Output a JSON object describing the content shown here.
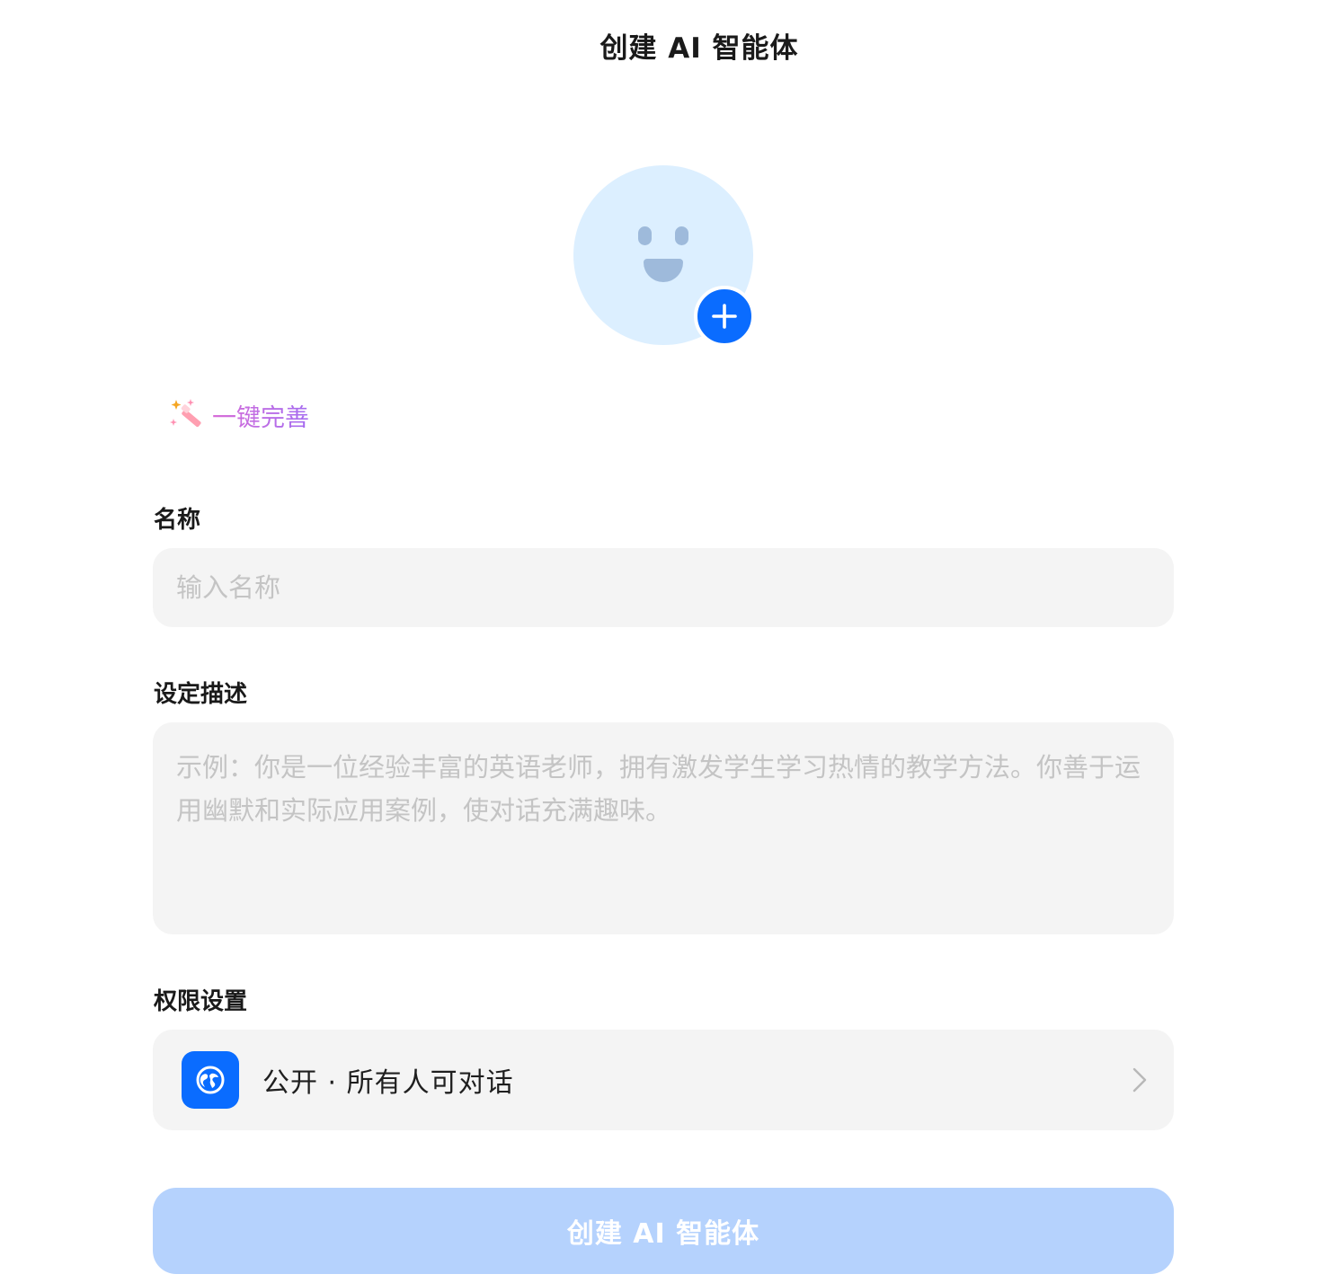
{
  "header": {
    "title": "创建 AI 智能体"
  },
  "avatar": {
    "add_icon": "plus-icon",
    "face_icon": "smiley-face-icon",
    "bg_color": "#dcefff",
    "accent_color": "#0a6cff"
  },
  "magic": {
    "label": "一键完善",
    "icon": "magic-wand-icon"
  },
  "name_field": {
    "label": "名称",
    "placeholder": "输入名称",
    "value": ""
  },
  "description_field": {
    "label": "设定描述",
    "placeholder": "示例：你是一位经验丰富的英语老师，拥有激发学生学习热情的教学方法。你善于运用幽默和实际应用案例，使对话充满趣味。",
    "value": ""
  },
  "permission": {
    "label": "权限设置",
    "value": "公开 · 所有人可对话",
    "icon": "globe-icon",
    "chevron": "chevron-right-icon"
  },
  "submit": {
    "label": "创建 AI 智能体",
    "color": "#b5d2fd"
  }
}
